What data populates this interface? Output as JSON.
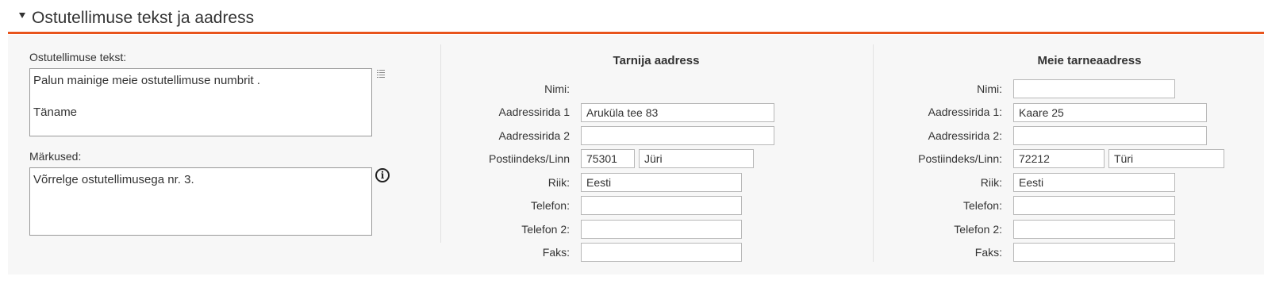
{
  "section": {
    "title": "Ostutellimuse tekst ja aadress"
  },
  "left": {
    "order_text_label": "Ostutellimuse tekst:",
    "order_text_value": "Palun mainige meie ostutellimuse numbrit .\n\nTäname",
    "notes_label": "Märkused:",
    "notes_value": "Võrrelge ostutellimusega nr. 3.",
    "info_glyph": "i"
  },
  "supplier": {
    "heading": "Tarnija aadress",
    "labels": {
      "name": "Nimi:",
      "line1": "Aadressirida 1",
      "line2": "Aadressirida 2",
      "postcode_city": "Postiindeks/Linn",
      "country": "Riik:",
      "phone": "Telefon:",
      "phone2": "Telefon 2:",
      "fax": "Faks:"
    },
    "values": {
      "line1": "Aruküla tee 83",
      "line2": "",
      "postcode": "75301",
      "city": "Jüri",
      "country": "Eesti",
      "phone": "",
      "phone2": "",
      "fax": ""
    }
  },
  "delivery": {
    "heading": "Meie tarneaadress",
    "labels": {
      "name": "Nimi:",
      "line1": "Aadressirida 1:",
      "line2": "Aadressirida 2:",
      "postcode_city": "Postiindeks/Linn:",
      "country": "Riik:",
      "phone": "Telefon:",
      "phone2": "Telefon 2:",
      "fax": "Faks:"
    },
    "values": {
      "name": "",
      "line1": "Kaare 25",
      "line2": "",
      "postcode": "72212",
      "city": "Türi",
      "country": "Eesti",
      "phone": "",
      "phone2": "",
      "fax": ""
    }
  }
}
